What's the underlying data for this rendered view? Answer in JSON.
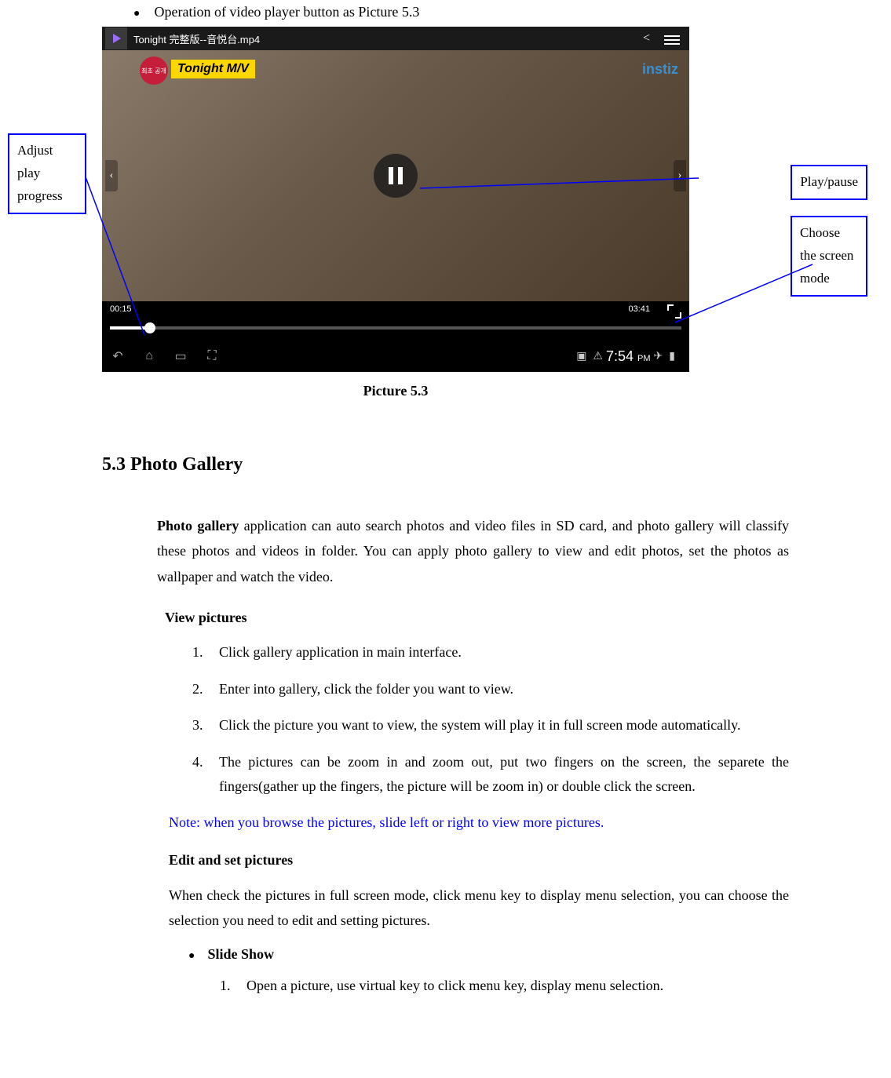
{
  "doc": {
    "intro_line": "Operation of video player button as Picture 5.3",
    "caption": "Picture 5.3",
    "section_heading": "5.3 Photo Gallery",
    "gallery_para_prefix": "Photo gallery",
    "gallery_para_rest": " application can auto search photos and video files in SD card, and photo gallery will classify these photos and videos in folder. You can apply photo gallery to view and edit photos, set the photos as wallpaper and watch the video.",
    "view_pictures_heading": "View pictures",
    "steps": [
      "Click gallery application in main interface.",
      "Enter into gallery, click the folder you want to view.",
      "Click the picture you want to view, the system will play it in full screen mode automatically.",
      "The pictures can be zoom in and zoom out, put two fingers on the screen, the separete the fingers(gather up the fingers, the picture will be zoom in) or double click the screen."
    ],
    "note_text": "Note: when you browse the pictures, slide left or right to view more pictures.",
    "edit_heading": "Edit and set pictures",
    "edit_para": "When check the pictures in full screen mode, click menu key to display menu selection, you can choose the selection you need to edit and setting pictures.",
    "slide_show_label": "Slide Show",
    "slide_show_step1": "Open a picture, use virtual key to click menu key, display menu selection."
  },
  "player": {
    "title": "Tonight 完整版--音悦台.mp4",
    "badge_text": "최초\n공개",
    "overlay_label": "Tonight M/V",
    "brand_label": "instiz",
    "time_elapsed": "00:15",
    "time_total": "03:41",
    "status_time": "7:54",
    "status_period": "PM"
  },
  "annotations": {
    "adjust_progress": "Adjust play progress",
    "play_pause": "Play/pause",
    "screen_mode": "Choose the screen mode"
  }
}
